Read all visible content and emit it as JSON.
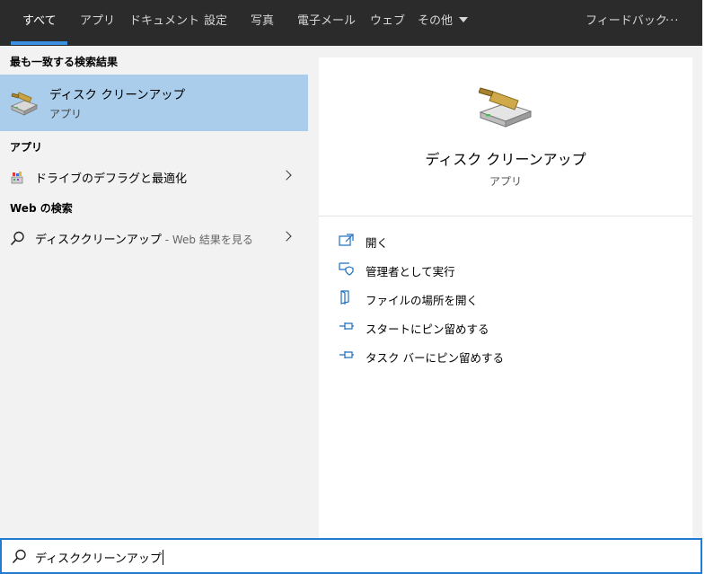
{
  "tabs": [
    {
      "label": "すべて"
    },
    {
      "label": "アプリ"
    },
    {
      "label": "ドキュメント"
    },
    {
      "label": "設定"
    },
    {
      "label": "写真"
    },
    {
      "label": "電子メール"
    },
    {
      "label": "ウェブ"
    },
    {
      "label": "その他"
    }
  ],
  "topbar": {
    "feedback_label": "フィードバック",
    "more_label": "···"
  },
  "results": {
    "best_match_title": "最も一致する検索結果",
    "best_match": {
      "name": "ディスク クリーンアップ",
      "type": "アプリ"
    },
    "apps_title": "アプリ",
    "apps": [
      {
        "name": "ドライブのデフラグと最適化"
      }
    ],
    "web_title": "Web の検索",
    "web": [
      {
        "query": "ディスククリーンアップ",
        "suffix": " - Web 結果を見る"
      }
    ]
  },
  "detail": {
    "name": "ディスク クリーンアップ",
    "type": "アプリ",
    "actions": [
      {
        "label": "開く",
        "icon": "open-icon"
      },
      {
        "label": "管理者として実行",
        "icon": "run-as-admin-icon"
      },
      {
        "label": "ファイルの場所を開く",
        "icon": "file-location-icon"
      },
      {
        "label": "スタートにピン留めする",
        "icon": "pin-icon"
      },
      {
        "label": "タスク バーにピン留めする",
        "icon": "pin-icon"
      }
    ]
  },
  "search": {
    "value": "ディスククリーンアップ"
  },
  "colors": {
    "accent": "#3b8fe0",
    "selected": "#a9cdea",
    "topbar": "#2b2b2b"
  }
}
